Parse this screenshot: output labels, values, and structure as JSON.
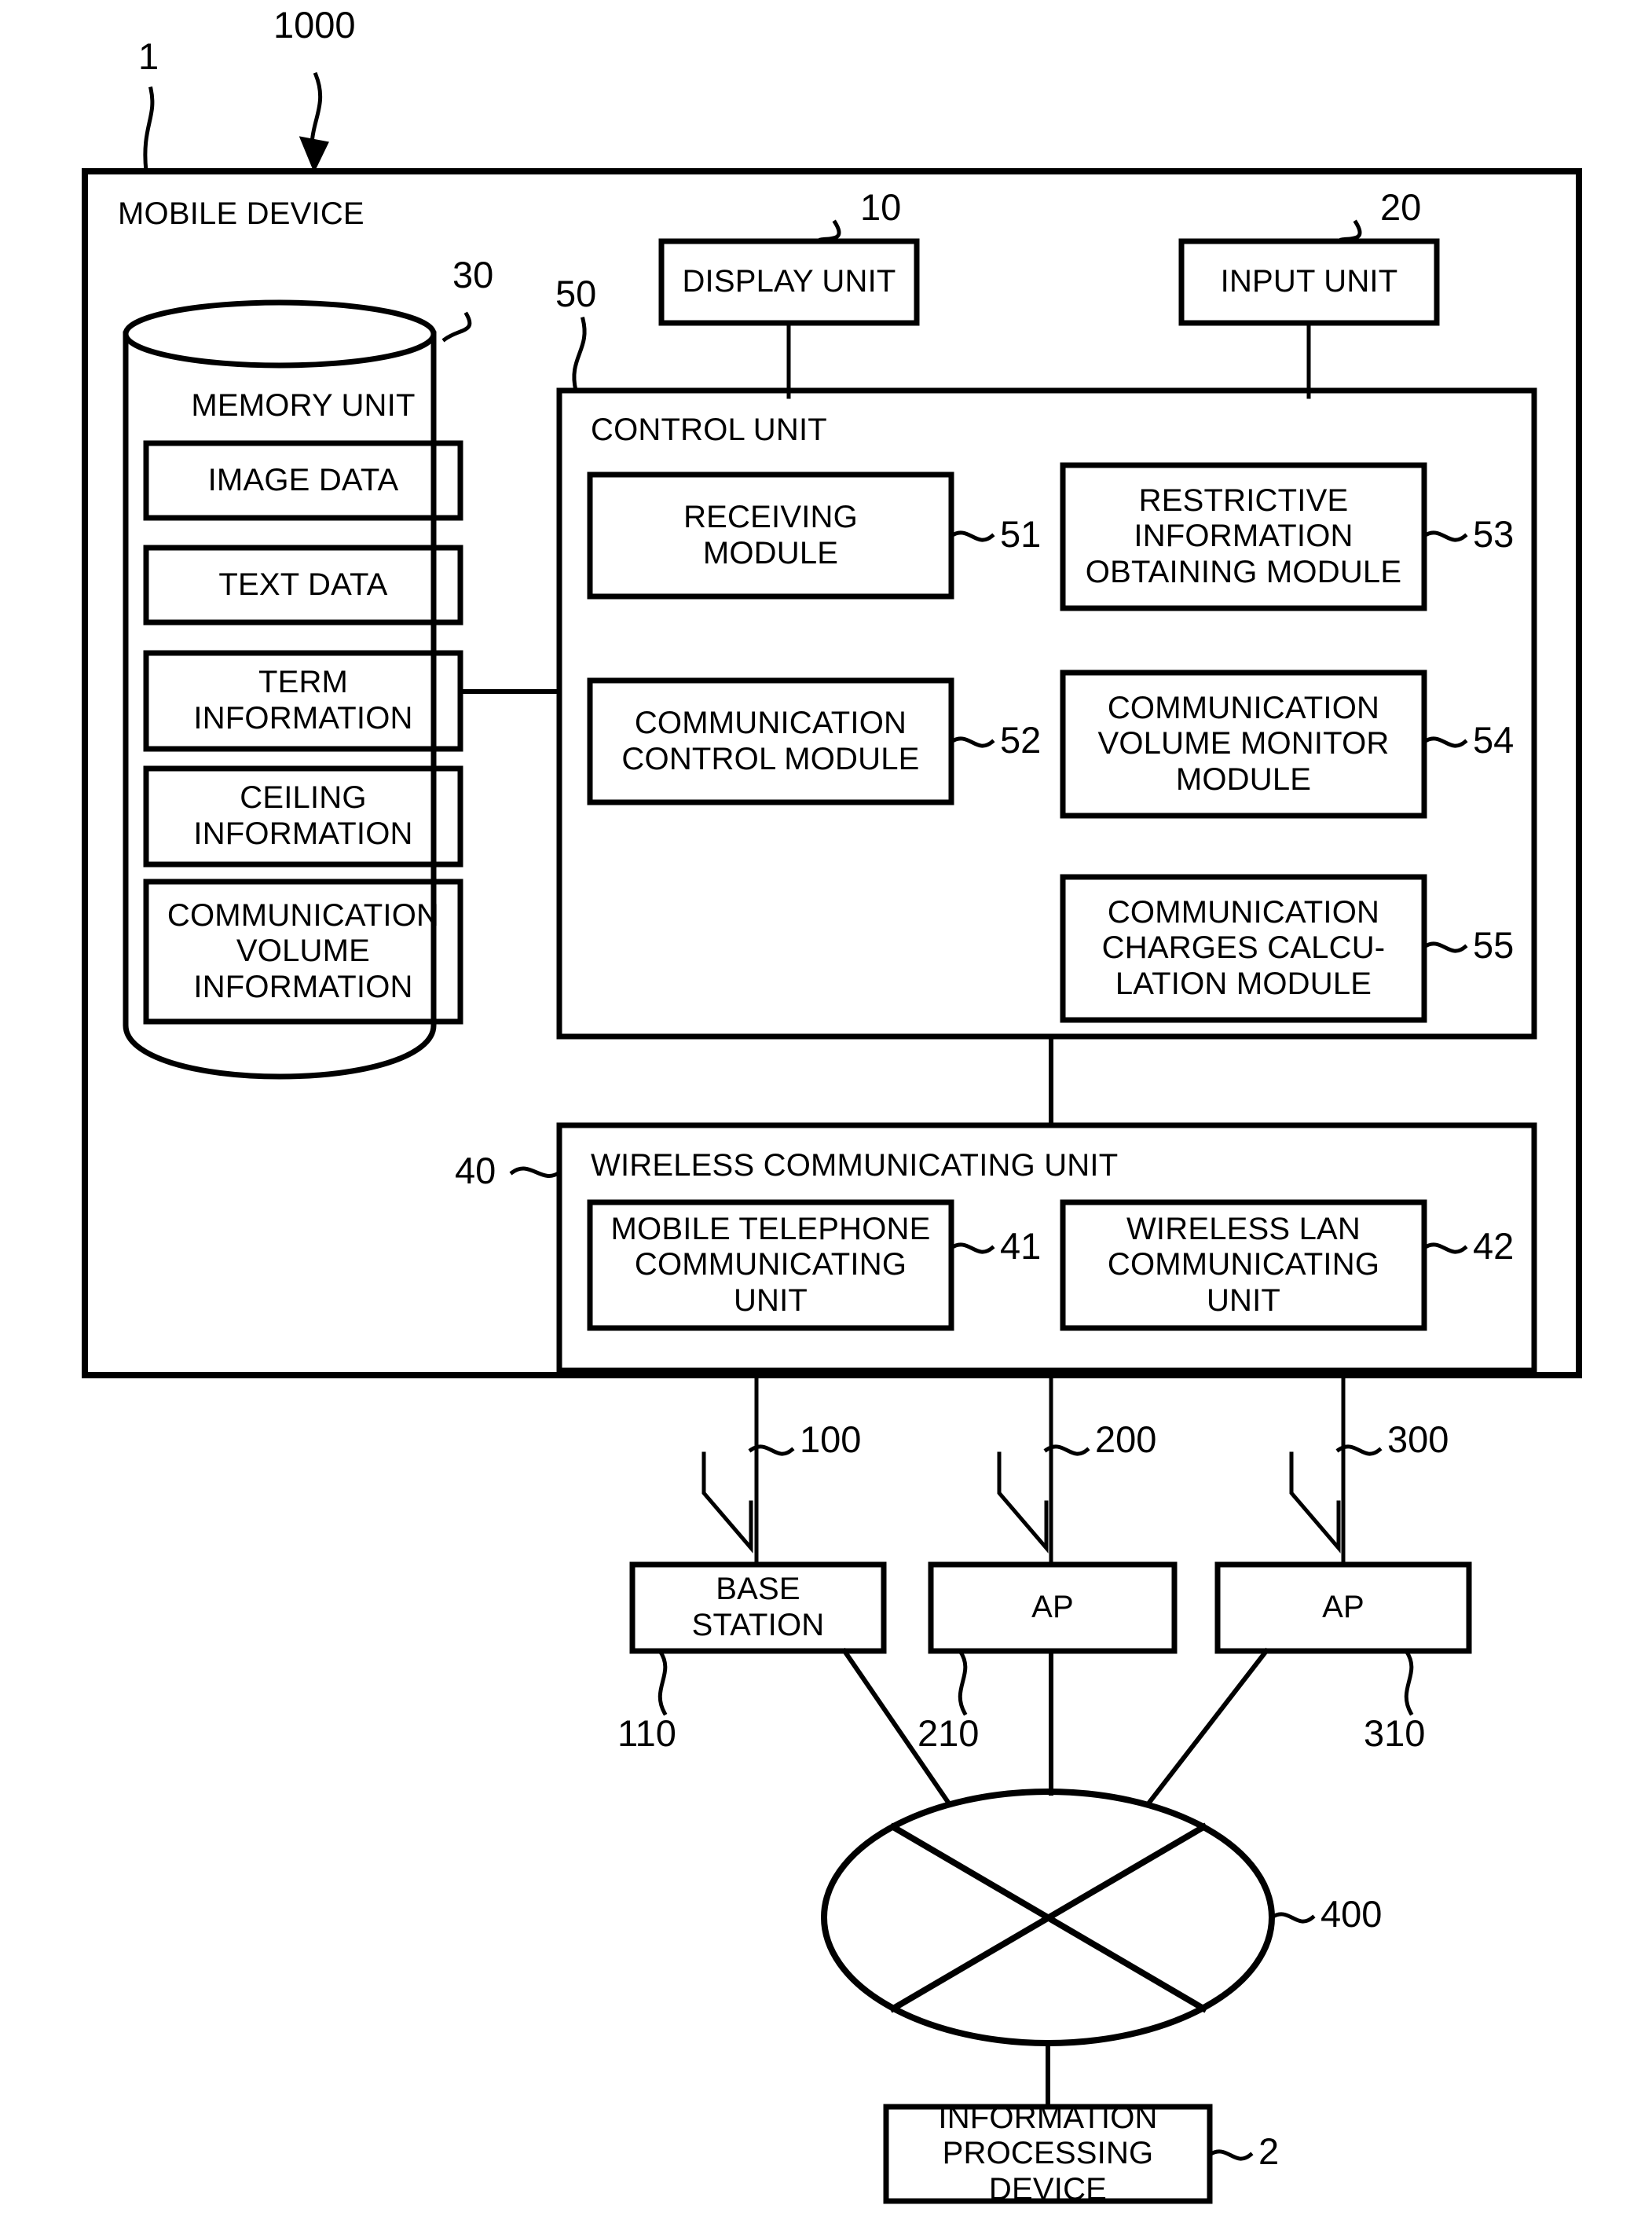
{
  "figure": {
    "type": "patent-block-diagram",
    "title_ref": "1000",
    "device_ref": "1"
  },
  "mobile_device": {
    "label": "MOBILE DEVICE",
    "ref": "1",
    "system_ref": "1000"
  },
  "display_unit": {
    "label": "DISPLAY UNIT",
    "ref": "10"
  },
  "input_unit": {
    "label": "INPUT UNIT",
    "ref": "20"
  },
  "memory_unit": {
    "label": "MEMORY UNIT",
    "ref": "30",
    "items": [
      {
        "label": "IMAGE DATA"
      },
      {
        "label": "TEXT DATA"
      },
      {
        "label": "TERM\nINFORMATION"
      },
      {
        "label": "CEILING\nINFORMATION"
      },
      {
        "label": "COMMUNICATION\nVOLUME\nINFORMATION"
      }
    ]
  },
  "control_unit": {
    "label": "CONTROL UNIT",
    "ref": "50",
    "modules": [
      {
        "label": "RECEIVING\nMODULE",
        "ref": "51"
      },
      {
        "label": "RESTRICTIVE\nINFORMATION\nOBTAINING MODULE",
        "ref": "53"
      },
      {
        "label": "COMMUNICATION\nCONTROL MODULE",
        "ref": "52"
      },
      {
        "label": "COMMUNICATION\nVOLUME MONITOR\nMODULE",
        "ref": "54"
      },
      {
        "label": "COMMUNICATION\nCHARGES CALCU-\nLATION MODULE",
        "ref": "55"
      }
    ]
  },
  "wireless_unit": {
    "label": "WIRELESS COMMUNICATING UNIT",
    "ref": "40",
    "modules": [
      {
        "label": "MOBILE TELEPHONE\nCOMMUNICATING\nUNIT",
        "ref": "41"
      },
      {
        "label": "WIRELESS LAN\nCOMMUNICATING\nUNIT",
        "ref": "42"
      }
    ]
  },
  "links": [
    {
      "ref": "100"
    },
    {
      "ref": "200"
    },
    {
      "ref": "300"
    }
  ],
  "stations": [
    {
      "label": "BASE\nSTATION",
      "ref": "110"
    },
    {
      "label": "AP",
      "ref": "210"
    },
    {
      "label": "AP",
      "ref": "310"
    }
  ],
  "network": {
    "ref": "400"
  },
  "server": {
    "label": "INFORMATION\nPROCESSING\nDEVICE",
    "ref": "2"
  },
  "style": {
    "stroke": "#000000",
    "background": "#ffffff"
  }
}
